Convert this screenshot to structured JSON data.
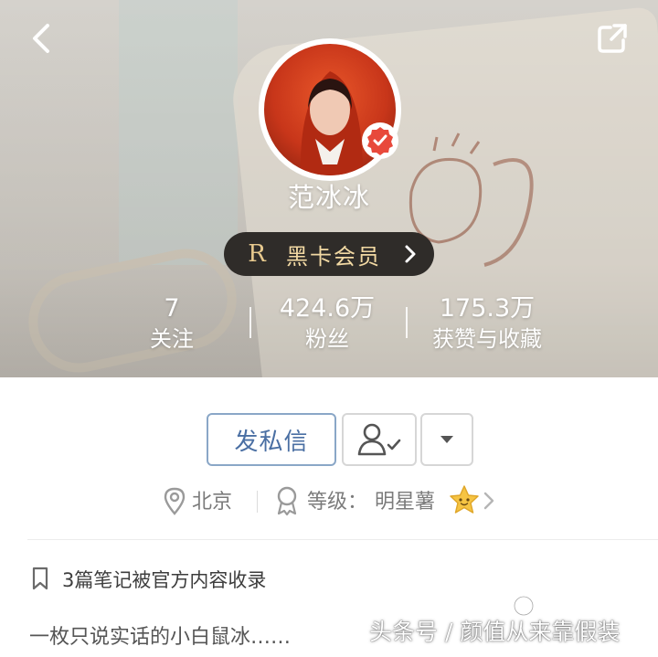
{
  "header": {
    "username": "范冰冰",
    "vip": {
      "letter": "R",
      "label": "黑卡会员"
    }
  },
  "stats": [
    {
      "value": "7",
      "label": "关注"
    },
    {
      "value": "424.6万",
      "label": "粉丝"
    },
    {
      "value": "175.3万",
      "label": "获赞与收藏"
    }
  ],
  "actions": {
    "message_label": "发私信"
  },
  "info": {
    "location": "北京",
    "level_label": "等级：",
    "level_value": "明星薯"
  },
  "notes": {
    "text": "3篇笔记被官方内容收录"
  },
  "bio": "一枚只说实话的小白鼠冰……",
  "watermark": "头条号 / 颜值从来靠假装",
  "colors": {
    "vip_bg": "#2f2c29",
    "vip_gold": "#f2d9a3",
    "message_blue": "#4a6fa3",
    "verified_red": "#e8493b"
  },
  "icons": [
    "back-arrow-icon",
    "share-icon",
    "verified-check-icon",
    "chevron-right-icon",
    "person-check-icon",
    "caret-down-icon",
    "location-pin-icon",
    "medal-icon",
    "star-icon",
    "bookmark-icon"
  ]
}
